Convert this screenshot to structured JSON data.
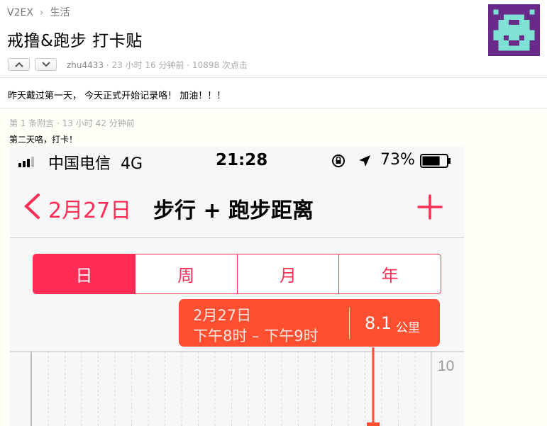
{
  "breadcrumb": {
    "site": "V2EX",
    "separator": "›",
    "node": "生活"
  },
  "topic": {
    "title": "戒撸&跑步 打卡贴",
    "author": "zhu4433",
    "meta_rest": " · 23 小时 16 分钟前 · 10898 次点击",
    "body": "昨天戴过第一天， 今天正式开始记录咯！ 加油！！！"
  },
  "vote": {
    "up_icon": "chevron-up-icon",
    "down_icon": "chevron-down-icon"
  },
  "avatar": {
    "icon": "pixel-invader-avatar",
    "bg": "#6a2a8a",
    "fg": "#7fe0d4"
  },
  "append": {
    "meta": "第 1 条附言  ·  13 小时 42 分钟前",
    "body": "第二天咯，打卡！"
  },
  "phone": {
    "status": {
      "carrier": "中国电信",
      "network": "4G",
      "time": "21:28",
      "battery": "73%",
      "battery_level": 0.73
    },
    "nav": {
      "date": "2月27日",
      "title": "步行 + 跑步距离"
    },
    "segments": [
      "日",
      "周",
      "月",
      "年"
    ],
    "selected_segment": "日",
    "callout": {
      "date": "2月27日",
      "range": "下午8时 – 下午9时",
      "value": "8.1",
      "unit": "公里"
    },
    "chart": {
      "y_label": "10"
    },
    "accent": "#ff2d55",
    "callout_color": "#ff4f30"
  }
}
